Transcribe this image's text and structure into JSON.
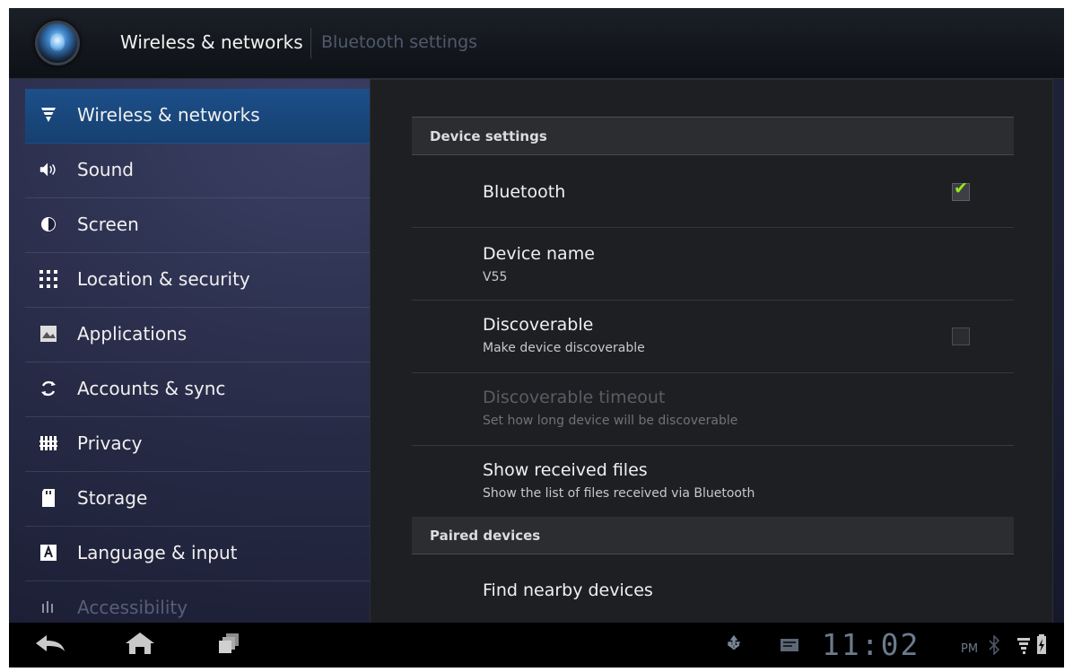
{
  "actionbar": {
    "title": "Wireless & networks",
    "subtitle": "Bluetooth settings",
    "app_icon": "settings-app-icon"
  },
  "sidebar": {
    "items": [
      {
        "label": "Wireless & networks",
        "icon": "wifi-icon",
        "selected": true
      },
      {
        "label": "Sound",
        "icon": "speaker-icon"
      },
      {
        "label": "Screen",
        "icon": "brightness-icon"
      },
      {
        "label": "Location & security",
        "icon": "location-grid-icon"
      },
      {
        "label": "Applications",
        "icon": "applications-icon"
      },
      {
        "label": "Accounts & sync",
        "icon": "sync-icon"
      },
      {
        "label": "Privacy",
        "icon": "privacy-icon"
      },
      {
        "label": "Storage",
        "icon": "sd-card-icon"
      },
      {
        "label": "Language & input",
        "icon": "language-icon"
      },
      {
        "label": "Accessibility",
        "icon": "accessibility-icon"
      }
    ]
  },
  "panel": {
    "device_settings_header": "Device settings",
    "bluetooth": {
      "title": "Bluetooth",
      "checked": true
    },
    "device_name": {
      "title": "Device name",
      "summary": "V55"
    },
    "discoverable": {
      "title": "Discoverable",
      "summary": "Make device discoverable",
      "checked": false
    },
    "discoverable_timeout": {
      "title": "Discoverable timeout",
      "summary": "Set how long device will be discoverable",
      "enabled": false
    },
    "show_received_files": {
      "title": "Show received files",
      "summary": "Show the list of files received via Bluetooth"
    },
    "paired_devices_header": "Paired devices",
    "find_nearby": {
      "title": "Find nearby devices"
    }
  },
  "systembar": {
    "time": "11:02",
    "ampm": "PM",
    "nav": [
      "back-icon",
      "home-icon",
      "recent-apps-icon"
    ],
    "status_icons": [
      "usb-icon",
      "notification-icon",
      "bluetooth-icon",
      "signal-battery-icon"
    ]
  },
  "colors": {
    "accent_selected": "#1d4f8a",
    "checkmark": "#9be31d",
    "clock": "#6c7a8b"
  }
}
